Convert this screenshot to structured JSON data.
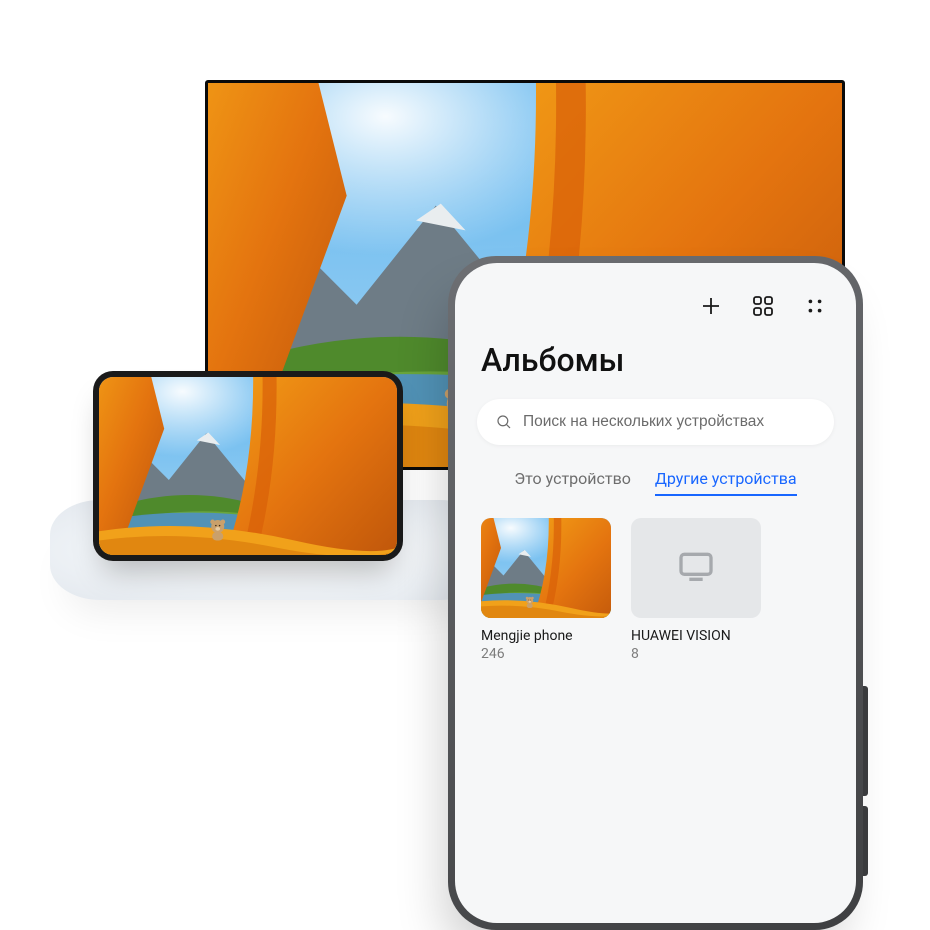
{
  "page": {
    "title": "Альбомы"
  },
  "search": {
    "placeholder": "Поиск на нескольких устройствах"
  },
  "tabs": {
    "this_device": "Это устройство",
    "other_devices": "Другие устройства",
    "active": "other_devices"
  },
  "devices": [
    {
      "name": "Mengjie phone",
      "count": "246",
      "kind": "phone"
    },
    {
      "name": "HUAWEI VISION",
      "count": "8",
      "kind": "tv"
    }
  ],
  "icons": {
    "plus": "plus-icon",
    "grid": "grid-icon",
    "more": "more-dots-icon",
    "search": "search-icon",
    "tv": "tv-icon"
  }
}
